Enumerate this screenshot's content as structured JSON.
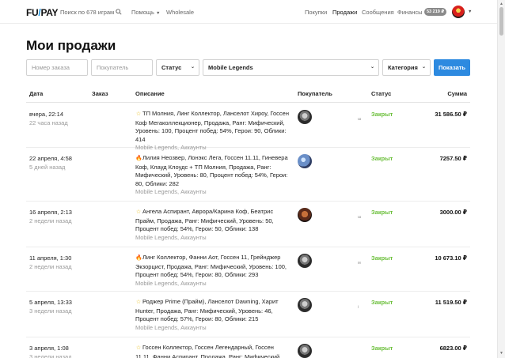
{
  "header": {
    "logo_left": "FU",
    "logo_slash": "/",
    "logo_right": "PAY",
    "search_label": "Поиск по 678 играм",
    "help_label": "Помощь",
    "wholesale_label": "Wholesale",
    "nav": [
      {
        "label": "Покупки",
        "active": false
      },
      {
        "label": "Продажи",
        "active": true
      },
      {
        "label": "Сообщения",
        "active": false
      },
      {
        "label": "Финансы",
        "active": false
      }
    ],
    "balance": "53 219 ₽"
  },
  "page_title": "Мои продажи",
  "filters": {
    "order_placeholder": "Номер заказа",
    "buyer_placeholder": "Покупатель",
    "status_label": "Статус",
    "game_value": "Mobile Legends",
    "category_label": "Категория",
    "show_button": "Показать"
  },
  "table": {
    "columns": [
      "Дата",
      "Заказ",
      "Описание",
      "Покупатель",
      "Статус",
      "Сумма"
    ],
    "rows": [
      {
        "date": "вчера, 22:14",
        "ago": "22 часа назад",
        "icon": "star",
        "description": "ТП Молния, Линг Коллектор, Ланселот Хироу, Госсен Коф Мегаколлекционер, Продажа, Ранг: Мифический, Уровень: 100, Процент побед: 54%, Герои: 90, Облики: 414",
        "game": "Mobile Legends, Аккаунты",
        "avatar": "knight",
        "marker": "ш",
        "status": "Закрыт",
        "sum": "31 586.50 ₽"
      },
      {
        "date": "22 апреля, 4:58",
        "ago": "5 дней назад",
        "icon": "fire",
        "description": "Лилия Неозвер, Лонэкс Лега, Госсен 11.11, Гиневера Коф, Клауд Клоудс + ТП Молния, Продажа, Ранг: Мифический, Уровень: 80, Процент побед: 54%, Герои: 80, Облики: 282",
        "game": "Mobile Legends, Аккаунты",
        "avatar": "planet",
        "marker": "",
        "status": "Закрыт",
        "sum": "7257.50 ₽"
      },
      {
        "date": "16 апреля, 2:13",
        "ago": "2 недели назад",
        "icon": "star",
        "description": "Ангела Аспирант, Аврора/Карина Коф, Беатрис Прайм, Продажа, Ранг: Мифический, Уровень: 50, Процент побед: 54%, Герои: 50, Облики: 138",
        "game": "Mobile Legends, Аккаунты",
        "avatar": "girl",
        "marker": "ш",
        "status": "Закрыт",
        "sum": "3000.00 ₽"
      },
      {
        "date": "11 апреля, 1:30",
        "ago": "2 недели назад",
        "icon": "fire",
        "description": "Линг Коллектор, Фанни Аот, Госсен 11, Грейнджер Экзорцист, Продажа, Ранг: Мифический, Уровень: 100, Процент побед: 54%, Герои: 80, Облики: 293",
        "game": "Mobile Legends, Аккаунты",
        "avatar": "knight",
        "marker": "м",
        "status": "Закрыт",
        "sum": "10 673.10 ₽"
      },
      {
        "date": "5 апреля, 13:33",
        "ago": "3 недели назад",
        "icon": "star",
        "description": "Роджер Prime (Прайм), Ланселот Dawning, Харит Hunter, Продажа, Ранг: Мифический, Уровень: 46, Процент побед: 57%, Герои: 80, Облики: 215",
        "game": "Mobile Legends, Аккаунты",
        "avatar": "knight",
        "marker": "і",
        "status": "Закрыт",
        "sum": "11 519.50 ₽"
      },
      {
        "date": "3 апреля, 1:08",
        "ago": "3 недели назад",
        "icon": "star",
        "description": "Госсен Коллектор, Госсен Легендарный, Госсен 11.11, Фанни Аспирант, Продажа, Ранг: Мифический, Уровень:",
        "game": "",
        "avatar": "knight",
        "marker": "",
        "status": "Закрыт",
        "sum": "6823.00 ₽"
      }
    ]
  },
  "colors": {
    "accent": "#2d8ae0",
    "status_closed": "#6bbf3a",
    "muted": "#999999"
  }
}
